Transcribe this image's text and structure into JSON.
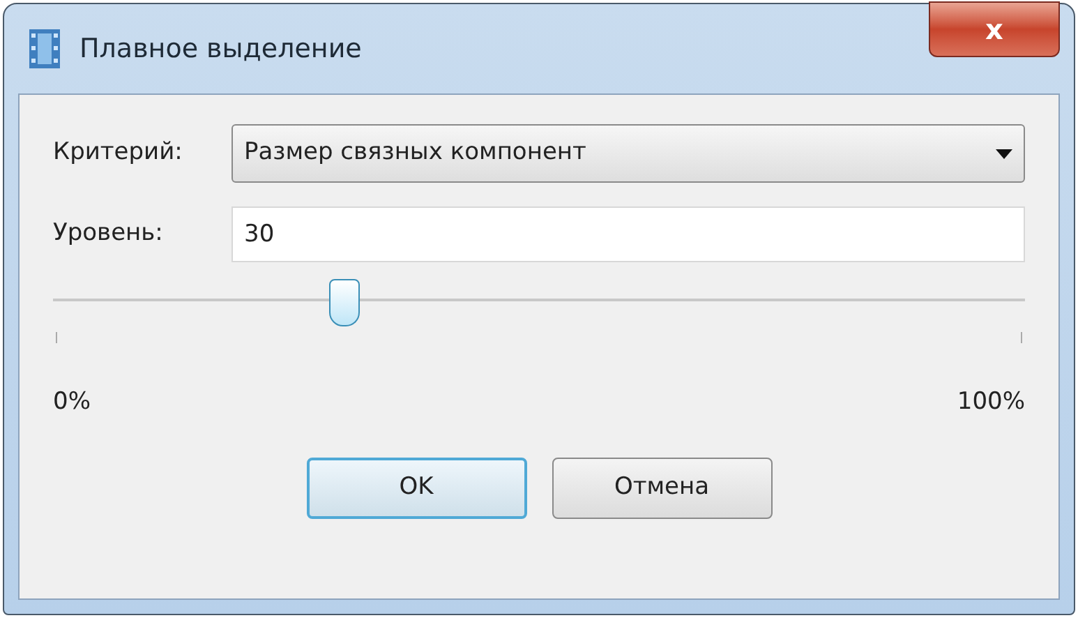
{
  "window": {
    "title": "Плавное выделение",
    "close": "x"
  },
  "criterion": {
    "label": "Критерий:",
    "value": "Размер связных компонент"
  },
  "level_field": {
    "label": "Уровень:",
    "value": "30"
  },
  "slider": {
    "level": 0.3,
    "min_label": "0%",
    "max_label": "100%"
  },
  "buttons": [
    {
      "label": "OK",
      "default": true
    },
    {
      "label": "Отмена",
      "default": false
    }
  ]
}
